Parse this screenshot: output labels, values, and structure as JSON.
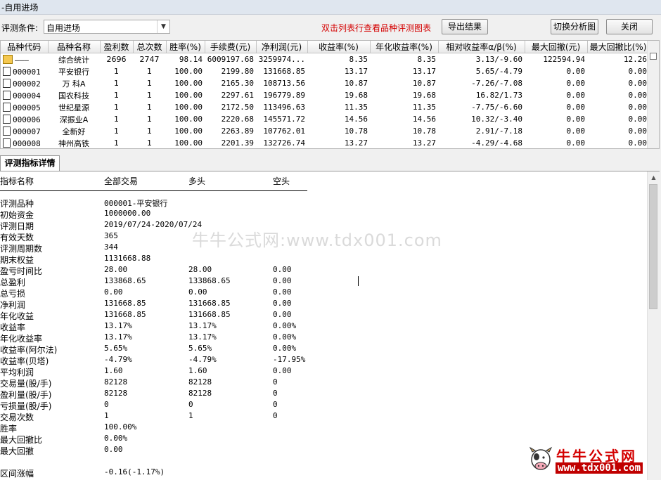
{
  "window": {
    "title": "-自用进场"
  },
  "toolbar": {
    "condition_label": "评测条件:",
    "condition_value": "自用进场",
    "hint": "双击列表行查看品种评测图表",
    "export_button": "导出结果",
    "switch_button": "切换分析图",
    "close_button": "关闭"
  },
  "grid": {
    "columns": [
      "品种代码",
      "品种名称",
      "盈利数",
      "总次数",
      "胜率(%)",
      "手续费(元)",
      "净利润(元)",
      "收益率(%)",
      "年化收益率(%)",
      "相对收益率α/β(%)",
      "最大回撤(元)",
      "最大回撤比(%)"
    ],
    "rows": [
      {
        "code": "———",
        "name": "综合统计",
        "win": "2696",
        "total": "2747",
        "rate": "98.14",
        "fee": "6009197.68",
        "profit": "3259974...",
        "ret": "8.35",
        "annual": "8.35",
        "alpha": "3.13/-9.60",
        "maxdd": "122594.94",
        "ddratio": "12.26"
      },
      {
        "code": "000001",
        "name": "平安银行",
        "win": "1",
        "total": "1",
        "rate": "100.00",
        "fee": "2199.80",
        "profit": "131668.85",
        "ret": "13.17",
        "annual": "13.17",
        "alpha": "5.65/-4.79",
        "maxdd": "0.00",
        "ddratio": "0.00"
      },
      {
        "code": "000002",
        "name": "万  科A",
        "win": "1",
        "total": "1",
        "rate": "100.00",
        "fee": "2165.30",
        "profit": "108713.56",
        "ret": "10.87",
        "annual": "10.87",
        "alpha": "-7.26/-7.08",
        "maxdd": "0.00",
        "ddratio": "0.00"
      },
      {
        "code": "000004",
        "name": "国农科技",
        "win": "1",
        "total": "1",
        "rate": "100.00",
        "fee": "2297.61",
        "profit": "196779.89",
        "ret": "19.68",
        "annual": "19.68",
        "alpha": "16.82/1.73",
        "maxdd": "0.00",
        "ddratio": "0.00"
      },
      {
        "code": "000005",
        "name": "世纪星源",
        "win": "1",
        "total": "1",
        "rate": "100.00",
        "fee": "2172.50",
        "profit": "113496.63",
        "ret": "11.35",
        "annual": "11.35",
        "alpha": "-7.75/-6.60",
        "maxdd": "0.00",
        "ddratio": "0.00"
      },
      {
        "code": "000006",
        "name": "深振业A",
        "win": "1",
        "total": "1",
        "rate": "100.00",
        "fee": "2220.68",
        "profit": "145571.72",
        "ret": "14.56",
        "annual": "14.56",
        "alpha": "10.32/-3.40",
        "maxdd": "0.00",
        "ddratio": "0.00"
      },
      {
        "code": "000007",
        "name": "全新好",
        "win": "1",
        "total": "1",
        "rate": "100.00",
        "fee": "2263.89",
        "profit": "107762.01",
        "ret": "10.78",
        "annual": "10.78",
        "alpha": "2.91/-7.18",
        "maxdd": "0.00",
        "ddratio": "0.00"
      },
      {
        "code": "000008",
        "name": "神州高铁",
        "win": "1",
        "total": "1",
        "rate": "100.00",
        "fee": "2201.39",
        "profit": "132726.74",
        "ret": "13.27",
        "annual": "13.27",
        "alpha": "-4.29/-4.68",
        "maxdd": "0.00",
        "ddratio": "0.00"
      }
    ]
  },
  "detail": {
    "tab_label": "评测指标详情",
    "headers": [
      "指标名称",
      "全部交易",
      "多头",
      "空头"
    ],
    "rows": [
      [
        "评测品种",
        "000001-平安银行",
        "",
        ""
      ],
      [
        "初始资金",
        "1000000.00",
        "",
        ""
      ],
      [
        "评测日期",
        "2019/07/24-2020/07/24",
        "",
        ""
      ],
      [
        "有效天数",
        "365",
        "",
        ""
      ],
      [
        "评测周期数",
        "344",
        "",
        ""
      ],
      [
        "期末权益",
        "1131668.88",
        "",
        ""
      ],
      [
        "盈亏时间比",
        "28.00",
        "28.00",
        "0.00"
      ],
      [
        "总盈利",
        "133868.65",
        "133868.65",
        "0.00"
      ],
      [
        "总亏损",
        "0.00",
        "0.00",
        "0.00"
      ],
      [
        "净利润",
        "131668.85",
        "131668.85",
        "0.00"
      ],
      [
        "年化收益",
        "131668.85",
        "131668.85",
        "0.00"
      ],
      [
        "收益率",
        "13.17%",
        "13.17%",
        "0.00%"
      ],
      [
        "年化收益率",
        "13.17%",
        "13.17%",
        "0.00%"
      ],
      [
        "收益率(阿尔法)",
        "5.65%",
        "5.65%",
        "0.00%"
      ],
      [
        "收益率(贝塔)",
        "-4.79%",
        "-4.79%",
        "-17.95%"
      ],
      [
        "平均利润",
        "1.60",
        "1.60",
        "0.00"
      ],
      [
        "交易量(股/手)",
        "82128",
        "82128",
        "0"
      ],
      [
        "盈利量(股/手)",
        "82128",
        "82128",
        "0"
      ],
      [
        "亏损量(股/手)",
        "0",
        "0",
        "0"
      ],
      [
        "交易次数",
        "1",
        "1",
        "0"
      ],
      [
        "胜率",
        "100.00%",
        "",
        ""
      ],
      [
        "最大回撤比",
        "0.00%",
        "",
        ""
      ],
      [
        "最大回撤",
        "0.00",
        "",
        ""
      ],
      [
        "",
        "",
        " ",
        ""
      ],
      [
        "区间涨幅",
        "-0.16(-1.17%)",
        "",
        ""
      ]
    ]
  },
  "watermark": {
    "text": "牛牛公式网:www.tdx001.com"
  },
  "logo": {
    "name": "牛牛公式网",
    "url": "www.tdx001.com",
    "icon": "cow-mascot-icon"
  }
}
